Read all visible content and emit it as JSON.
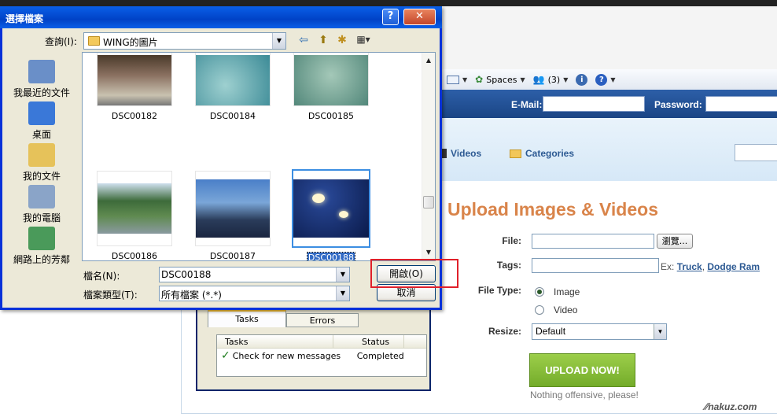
{
  "dialog": {
    "title": "選擇檔案",
    "help_glyph": "?",
    "close_glyph": "✕",
    "lookin_label": "查詢(I):",
    "lookin_value": "WING的圖片",
    "nav_glyphs": {
      "back": "⇦",
      "up": "⬆",
      "newfolder": "✱",
      "views": "▦▾"
    },
    "places": [
      {
        "label": "我最近的文件",
        "color": "#6a8fc8"
      },
      {
        "label": "桌面",
        "color": "#3a78d8"
      },
      {
        "label": "我的文件",
        "color": "#e6c25a"
      },
      {
        "label": "我的電腦",
        "color": "#8aa4c8"
      },
      {
        "label": "網路上的芳鄰",
        "color": "#4a9a5a"
      }
    ],
    "files": [
      {
        "name": "DSC00182"
      },
      {
        "name": "DSC00184"
      },
      {
        "name": "DSC00185"
      },
      {
        "name": "DSC00186"
      },
      {
        "name": "DSC00187"
      },
      {
        "name": "DSC00188",
        "selected": true
      }
    ],
    "filename_label": "檔名(N):",
    "filename_value": "DSC00188",
    "filetype_label": "檔案類型(T):",
    "filetype_value": "所有檔案 (*.*)",
    "open_button": "開啟(O)",
    "cancel_button": "取消"
  },
  "browser_toolbar": {
    "spaces_label": "Spaces",
    "contacts_label": "(3)"
  },
  "site": {
    "email_label": "E-Mail:",
    "password_label": "Password:",
    "nav_videos": "Videos",
    "nav_categories": "Categories",
    "upload_title": "Upload Images & Videos",
    "file_label": "File:",
    "browse_button": "瀏覽...",
    "tags_label": "Tags:",
    "tags_example_prefix": "Ex:",
    "tags_example_1": "Truck",
    "tags_example_sep": ",",
    "tags_example_2": "Dodge Ram",
    "filetype_label": "File Type:",
    "filetype_options": [
      "Image",
      "Video"
    ],
    "filetype_selected": "Image",
    "resize_label": "Resize:",
    "resize_value": "Default",
    "upload_button": "UPLOAD NOW!",
    "note": "Nothing offensive, please!",
    "watermark": "nakuz.com"
  },
  "messenger": {
    "tabs": [
      "Tasks",
      "Errors"
    ],
    "columns": [
      "Tasks",
      "Status"
    ],
    "rows": [
      {
        "task": "Check for new messages",
        "status": "Completed"
      }
    ]
  }
}
